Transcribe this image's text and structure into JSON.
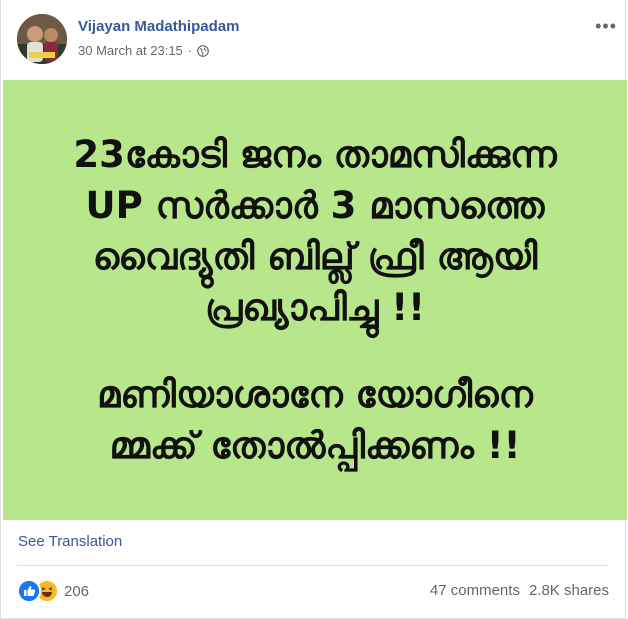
{
  "post": {
    "author": "Vijayan Madathipadam",
    "timestamp": "30 March at 23:15",
    "separator": "·",
    "privacy_icon": "globe-icon",
    "more_label": "•••"
  },
  "image": {
    "background": "#b8e68a",
    "lines": [
      "23കോടി ജനം താമസിക്കുന്ന",
      "UP സർക്കാർ 3 മാസത്തെ",
      "വൈദ്യുതി ബില്ല് ഫ്രീ ആയി",
      "പ്രഖ്യാപിച്ചു !!",
      "മണിയാശാനേ യോഗീനെ",
      "മ്മക്ക് തോൽപ്പിക്കണം !!"
    ]
  },
  "see_translation": "See Translation",
  "footer": {
    "reaction_icons": [
      "like-icon",
      "haha-icon"
    ],
    "reaction_count": "206",
    "comments": "47 comments",
    "shares": "2.8K shares"
  },
  "colors": {
    "link": "#385898",
    "meta": "#606770",
    "like": "#1877f2",
    "haha": "#f7b928"
  }
}
